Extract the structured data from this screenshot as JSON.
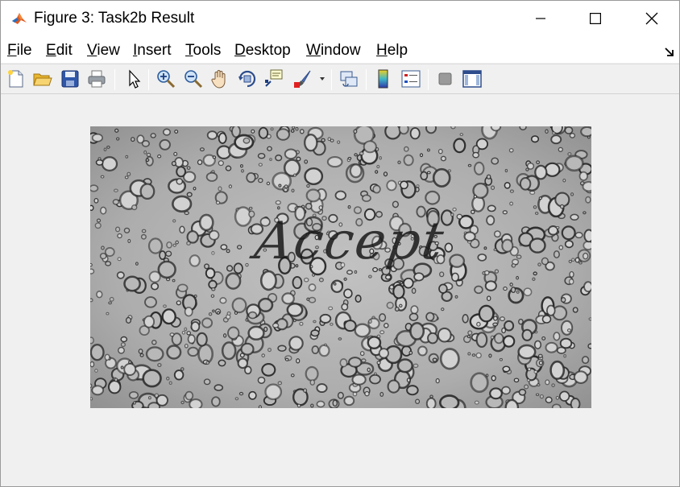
{
  "window": {
    "title": "Figure 3: Task2b Result",
    "app_icon": "matlab-logo-icon"
  },
  "menubar": {
    "items": [
      {
        "label": "File",
        "mnemonic": "F",
        "rest": "ile"
      },
      {
        "label": "Edit",
        "mnemonic": "E",
        "rest": "dit"
      },
      {
        "label": "View",
        "mnemonic": "V",
        "rest": "iew"
      },
      {
        "label": "Insert",
        "mnemonic": "I",
        "rest": "nsert"
      },
      {
        "label": "Tools",
        "mnemonic": "T",
        "rest": "ools"
      },
      {
        "label": "Desktop",
        "mnemonic": "D",
        "rest": "esktop"
      },
      {
        "label": "Window",
        "mnemonic": "W",
        "rest": "indow"
      },
      {
        "label": "Help",
        "mnemonic": "H",
        "rest": "elp"
      }
    ]
  },
  "toolbar": {
    "buttons": [
      "new-figure-icon",
      "open-file-icon",
      "save-icon",
      "print-icon",
      "edit-plot-arrow-icon",
      "zoom-in-icon",
      "zoom-out-icon",
      "pan-hand-icon",
      "rotate-3d-icon",
      "data-cursor-icon",
      "brush-icon",
      "link-plot-icon",
      "colorbar-icon",
      "legend-icon",
      "hide-plot-tools-icon",
      "show-plot-tools-icon"
    ]
  },
  "figure": {
    "image": {
      "description_tag": "water-droplets-image",
      "watermark_text": "Accept"
    }
  },
  "colors": {
    "window_bg": "#f0f0f0",
    "titlebar_bg": "#ffffff",
    "image_gray": "#a9a9a9"
  }
}
